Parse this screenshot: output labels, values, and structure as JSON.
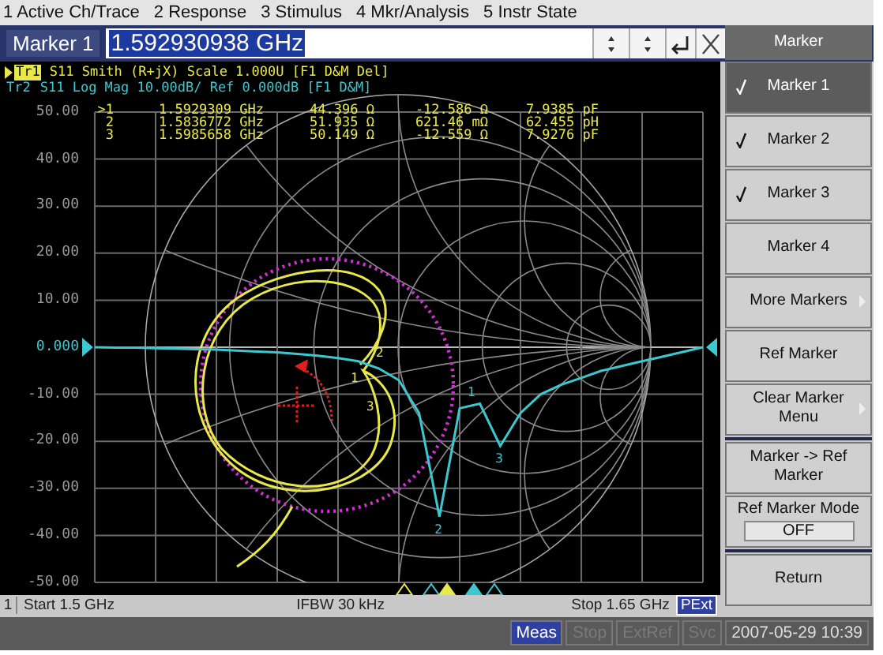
{
  "menu_bar": [
    {
      "label": "1 Active Ch/Trace"
    },
    {
      "label": "2 Response"
    },
    {
      "label": "3 Stimulus"
    },
    {
      "label": "4 Mkr/Analysis"
    },
    {
      "label": "5 Instr State"
    }
  ],
  "entry_bar": {
    "label": "Marker 1",
    "value": "1.592930938 GHz",
    "selected": true
  },
  "trace_header": [
    {
      "trace": "Tr1",
      "rest": "S11 Smith (R+jX) Scale 1.000U [F1 D&M Del]",
      "active": true,
      "color": "#e8e84a"
    },
    {
      "trace": "Tr2",
      "rest": "S11 Log Mag 10.00dB/ Ref 0.000dB [F1 D&M]",
      "active": false,
      "color": "#3cc8d0"
    }
  ],
  "marker_table": [
    {
      "marker": ">1",
      "frequency": "1.5929309 GHz",
      "resistance": "44.396 Ω",
      "reactance": "-12.586 Ω",
      "equivalent": "7.9385 pF"
    },
    {
      "marker": "2",
      "frequency": "1.5836772 GHz",
      "resistance": "51.935 Ω",
      "reactance": "621.46 mΩ",
      "equivalent": "62.455 pH"
    },
    {
      "marker": "3",
      "frequency": "1.5985658 GHz",
      "resistance": "50.149 Ω",
      "reactance": "-12.559 Ω",
      "equivalent": "7.9276 pF"
    }
  ],
  "log_mag_trace": {
    "chart_data": {
      "type": "line",
      "ylim": [
        -50,
        50
      ],
      "grid": true,
      "yticks": [
        {
          "value": 50,
          "label": "50.00"
        },
        {
          "value": 40,
          "label": "40.00"
        },
        {
          "value": 30,
          "label": "30.00"
        },
        {
          "value": 20,
          "label": "20.00"
        },
        {
          "value": 10,
          "label": "10.00"
        },
        {
          "value": 0,
          "label": "0.000"
        },
        {
          "value": -10,
          "label": "-10.00"
        },
        {
          "value": -20,
          "label": "-20.00"
        },
        {
          "value": -30,
          "label": "-30.00"
        },
        {
          "value": -40,
          "label": "-40.00"
        },
        {
          "value": -50,
          "label": "-50.00"
        }
      ],
      "categories": [
        null,
        null,
        null,
        null,
        null,
        null,
        null,
        null,
        null,
        null,
        null,
        null,
        null,
        null,
        null,
        null,
        null,
        null,
        null,
        null,
        null,
        null,
        null,
        null,
        null,
        null,
        null,
        null,
        null,
        null,
        null
      ],
      "series": [
        {
          "color": "#3cc8d0",
          "values": [
            0,
            -0.1,
            -0.1,
            -0.2,
            -0.3,
            -0.4,
            -0.5,
            -0.7,
            -0.9,
            -1.1,
            -1.4,
            -1.8,
            -2.3,
            -3,
            -4.5,
            -7,
            -14,
            -36,
            -13,
            -12,
            -21,
            -14,
            -10,
            -8,
            -6.5,
            -5,
            -4,
            -3,
            -2,
            -1,
            0
          ]
        }
      ]
    }
  },
  "trace_markers": [
    {
      "label": "1",
      "color": "#3cc8d0"
    },
    {
      "label": "2",
      "color": "#3cc8d0"
    },
    {
      "label": "3",
      "color": "#3cc8d0"
    },
    {
      "label": "1",
      "color": "#e8e84a"
    },
    {
      "label": "2",
      "color": "#e8e84a"
    },
    {
      "label": "3",
      "color": "#e8e84a"
    }
  ],
  "channel_bar": {
    "channel": "1",
    "start": "Start 1.5 GHz",
    "ifbw": "IFBW 30 kHz",
    "stop": "Stop 1.65 GHz",
    "badge": "PExt"
  },
  "softkeys": {
    "title": "Marker",
    "items": [
      {
        "label": "Marker 1",
        "kind": "key",
        "checked": true,
        "selected": true,
        "submenu": false,
        "separator_before": false
      },
      {
        "label": "Marker 2",
        "kind": "key",
        "checked": true,
        "selected": false,
        "submenu": false,
        "separator_before": false
      },
      {
        "label": "Marker 3",
        "kind": "key",
        "checked": true,
        "selected": false,
        "submenu": false,
        "separator_before": false
      },
      {
        "label": "Marker 4",
        "kind": "key",
        "checked": false,
        "selected": false,
        "submenu": false,
        "separator_before": false
      },
      {
        "label": "More Markers",
        "kind": "key",
        "checked": false,
        "selected": false,
        "submenu": true,
        "separator_before": false
      },
      {
        "label": "Ref Marker",
        "kind": "key",
        "checked": false,
        "selected": false,
        "submenu": false,
        "separator_before": false
      },
      {
        "label": "Clear Marker Menu",
        "kind": "key",
        "checked": false,
        "selected": false,
        "submenu": true,
        "separator_before": false
      },
      {
        "label": "Marker -> Ref Marker",
        "kind": "key",
        "checked": false,
        "selected": false,
        "submenu": false,
        "separator_before": true
      },
      {
        "label": "Ref Marker Mode",
        "kind": "setting",
        "value": "OFF",
        "checked": false,
        "selected": false,
        "submenu": false,
        "separator_before": false
      },
      {
        "label": "Return",
        "kind": "key",
        "checked": false,
        "selected": false,
        "submenu": false,
        "separator_before": true
      }
    ]
  },
  "status_bar": [
    {
      "label": "Meas",
      "active": true,
      "disabled": false
    },
    {
      "label": "Stop",
      "active": false,
      "disabled": true
    },
    {
      "label": "ExtRef",
      "active": false,
      "disabled": true
    },
    {
      "label": "Svc",
      "active": false,
      "disabled": true
    },
    {
      "label": "2007-05-29 10:39",
      "active": false,
      "disabled": false
    }
  ]
}
